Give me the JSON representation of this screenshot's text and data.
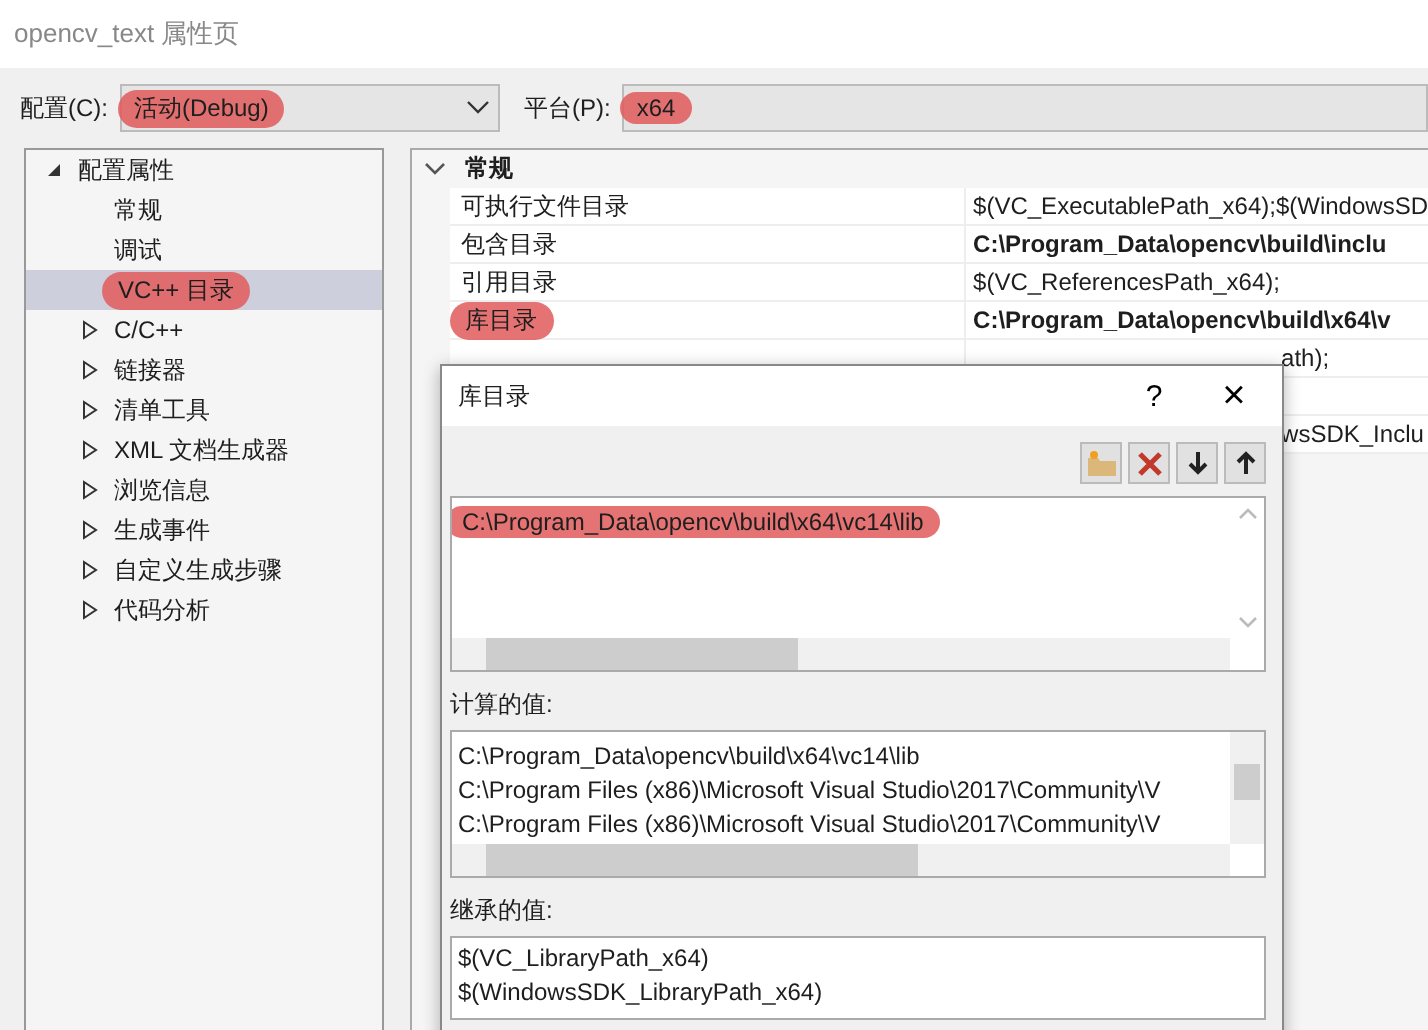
{
  "window": {
    "title": "opencv_text 属性页"
  },
  "config_bar": {
    "config_label": "配置(C):",
    "config_value": "活动(Debug)",
    "config_marked": true,
    "platform_label": "平台(P):",
    "platform_value": "x64",
    "platform_marked": true
  },
  "tree": [
    {
      "label": "配置属性",
      "expanded": true,
      "selected": false,
      "marked": false,
      "children": [
        {
          "label": "常规",
          "selected": false,
          "marked": false
        },
        {
          "label": "调试",
          "selected": false,
          "marked": false
        },
        {
          "label": "VC++ 目录",
          "selected": true,
          "marked": true
        },
        {
          "label": "C/C++",
          "expanded": false,
          "selected": false,
          "marked": false
        },
        {
          "label": "链接器",
          "expanded": false,
          "selected": false,
          "marked": false
        },
        {
          "label": "清单工具",
          "expanded": false,
          "selected": false,
          "marked": false
        },
        {
          "label": "XML 文档生成器",
          "expanded": false,
          "selected": false,
          "marked": false
        },
        {
          "label": "浏览信息",
          "expanded": false,
          "selected": false,
          "marked": false
        },
        {
          "label": "生成事件",
          "expanded": false,
          "selected": false,
          "marked": false
        },
        {
          "label": "自定义生成步骤",
          "expanded": false,
          "selected": false,
          "marked": false
        },
        {
          "label": "代码分析",
          "expanded": false,
          "selected": false,
          "marked": false
        }
      ]
    }
  ],
  "grid": {
    "section": "常规",
    "expanded": true,
    "rows": [
      {
        "kind": "full",
        "label": "可执行文件目录",
        "value": "$(VC_ExecutablePath_x64);$(WindowsSD",
        "bold": false,
        "marked": false
      },
      {
        "kind": "full",
        "label": "包含目录",
        "value": "C:\\Program_Data\\opencv\\build\\inclu",
        "bold": true,
        "marked": false
      },
      {
        "kind": "full",
        "label": "引用目录",
        "value": "$(VC_ReferencesPath_x64);",
        "bold": false,
        "marked": false
      },
      {
        "kind": "full",
        "label": "库目录",
        "value": "C:\\Program_Data\\opencv\\build\\x64\\v",
        "bold": true,
        "marked": true
      },
      {
        "kind": "covered",
        "value": "ath);",
        "bold": false
      },
      {
        "kind": "blank"
      },
      {
        "kind": "covered",
        "value": "wsSDK_Inclu",
        "bold": false
      }
    ]
  },
  "dialog": {
    "title": "库目录",
    "help": "?",
    "close": "×",
    "entries": [
      {
        "text": "C:\\Program_Data\\opencv\\build\\x64\\vc14\\lib",
        "marked": true
      }
    ],
    "computed_label": "计算的值:",
    "computed": [
      "C:\\Program_Data\\opencv\\build\\x64\\vc14\\lib",
      "C:\\Program Files (x86)\\Microsoft Visual Studio\\2017\\Community\\V",
      "C:\\Program Files (x86)\\Microsoft Visual Studio\\2017\\Community\\V"
    ],
    "inherited_label": "继承的值:",
    "inherited": [
      "$(VC_LibraryPath_x64)",
      "$(WindowsSDK_LibraryPath_x64)"
    ]
  }
}
